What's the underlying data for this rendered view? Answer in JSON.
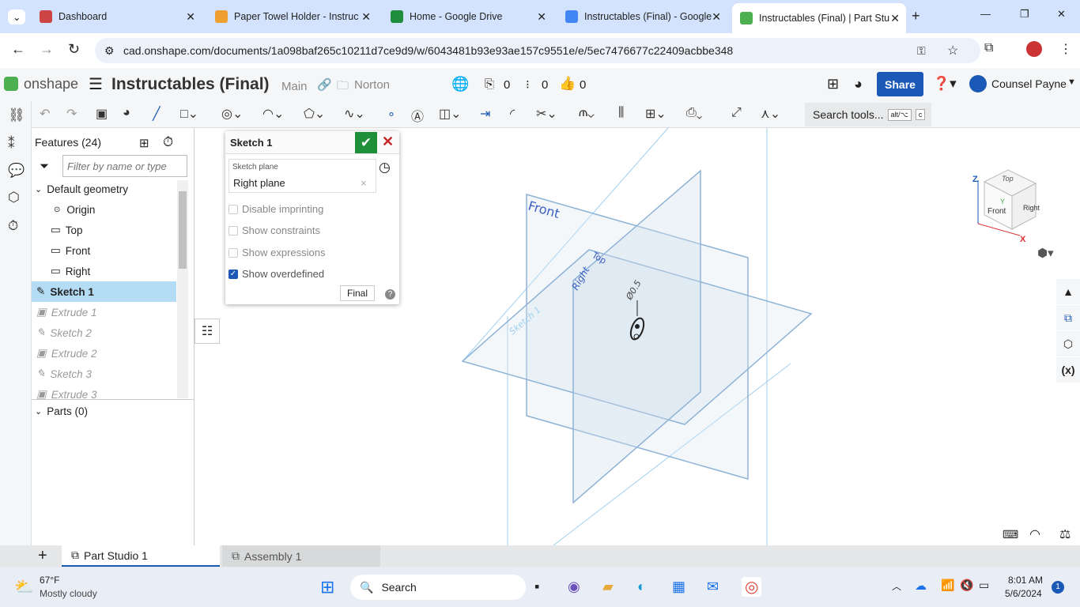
{
  "browser": {
    "tabs": [
      {
        "label": "Dashboard",
        "color": "#c44"
      },
      {
        "label": "Paper Towel Holder - Instruc",
        "color": "#f0a030"
      },
      {
        "label": "Home - Google Drive",
        "color": "#1e8e3e"
      },
      {
        "label": "Instructables (Final) - Google",
        "color": "#4285f4"
      },
      {
        "label": "Instructables (Final) | Part Stu",
        "color": "#4caf50"
      }
    ],
    "url": "cad.onshape.com/documents/1a098baf265c10211d7ce9d9/w/6043481b93e93ae157c9551e/e/5ec7476677c22409acbbe348"
  },
  "app": {
    "logo": "onshape",
    "doc_title": "Instructables (Final)",
    "branch": "Main",
    "folder": "Norton",
    "count1": "0",
    "count2": "0",
    "count3": "0",
    "share": "Share",
    "user": "Counsel Payne",
    "search_tools": "Search tools...",
    "shortcut1": "alt/⌥",
    "shortcut2": "c",
    "accent": "#1a59b5"
  },
  "features": {
    "title": "Features (24)",
    "filter_placeholder": "Filter by name or type",
    "group": "Default geometry",
    "items": [
      {
        "label": "Origin"
      },
      {
        "label": "Top"
      },
      {
        "label": "Front"
      },
      {
        "label": "Right"
      },
      {
        "label": "Sketch 1"
      },
      {
        "label": "Extrude 1"
      },
      {
        "label": "Sketch 2"
      },
      {
        "label": "Extrude 2"
      },
      {
        "label": "Sketch 3"
      },
      {
        "label": "Extrude 3"
      }
    ],
    "parts": "Parts (0)"
  },
  "dialog": {
    "title": "Sketch 1",
    "plane_label": "Sketch plane",
    "plane_value": "Right plane",
    "options": [
      {
        "label": "Disable imprinting",
        "checked": false
      },
      {
        "label": "Show constraints",
        "checked": false
      },
      {
        "label": "Show expressions",
        "checked": false
      },
      {
        "label": "Show overdefined",
        "checked": true
      }
    ],
    "final": "Final"
  },
  "viewport": {
    "planes": [
      "Front",
      "Top",
      "Right",
      "Sketch 1"
    ],
    "dimension": "Ø0.5",
    "cube": {
      "top": "Top",
      "front": "Front",
      "right": "Right",
      "z": "Z",
      "x": "X",
      "y": "Y"
    }
  },
  "tabs": [
    {
      "label": "Part Studio 1",
      "active": true
    },
    {
      "label": "Assembly 1",
      "active": false
    }
  ],
  "taskbar": {
    "temp": "67°F",
    "weather": "Mostly cloudy",
    "search": "Search",
    "time": "8:01 AM",
    "date": "5/6/2024",
    "badge": "1"
  }
}
